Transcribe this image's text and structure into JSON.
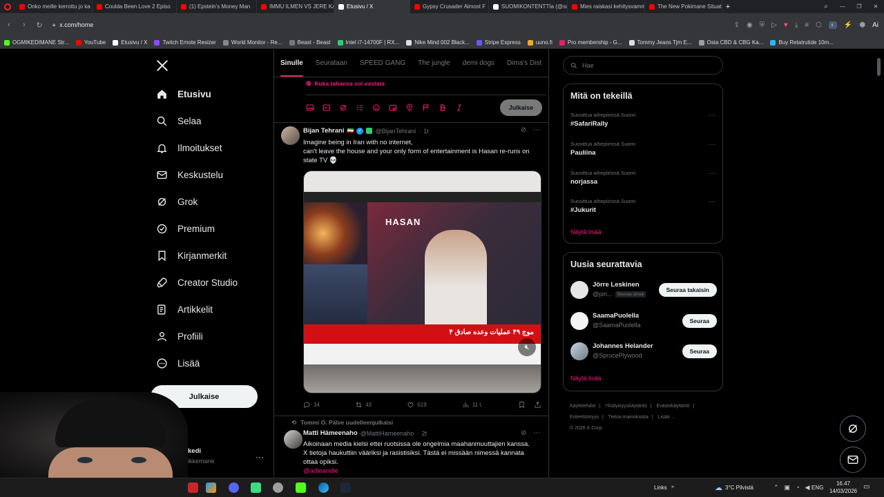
{
  "browser": {
    "tabs": [
      {
        "label": "Onko meille kerrottu jo ka",
        "color": "#ff0000"
      },
      {
        "label": "Coulda Been Love 2 Episo",
        "color": "#ff0000"
      },
      {
        "label": "(1) Epstein's Money Man",
        "color": "#ff0000"
      },
      {
        "label": "IMMU ILMEN VS JERE KA",
        "color": "#ff0000"
      },
      {
        "label": "Etusivu / X",
        "color": "#ffffff"
      },
      {
        "label": "Gypsy Crusader Almost F",
        "color": "#ff0000"
      },
      {
        "label": "SUOMIKONTENTTIa (@su",
        "color": "#ffffff"
      },
      {
        "label": "Mies raiskasi kehitysvamm",
        "color": "#ff0000"
      },
      {
        "label": "The New Pokimane Situat",
        "color": "#ff0000"
      }
    ],
    "url": "x.com/home",
    "bookmarks": [
      {
        "label": "OGMIKEDIMANE Str...",
        "color": "#53fc18"
      },
      {
        "label": "YouTube",
        "color": "#ff0000"
      },
      {
        "label": "Etusivu / X",
        "color": "#ffffff"
      },
      {
        "label": "Twitch Emote Resizer",
        "color": "#9146ff"
      },
      {
        "label": "World Monitor - Re...",
        "color": "#888888"
      },
      {
        "label": "Beast - Beast",
        "color": "#777777"
      },
      {
        "label": "Intel i7-14700F | RX...",
        "color": "#2ecc71"
      },
      {
        "label": "Nike Mind 002 Black...",
        "color": "#dddddd"
      },
      {
        "label": "Stripe Express",
        "color": "#635bff"
      },
      {
        "label": "uuno.fi",
        "color": "#f5a623"
      },
      {
        "label": "Pro membership - G...",
        "color": "#e91e63"
      },
      {
        "label": "Tommy Jeans Tjm E...",
        "color": "#dddddd"
      },
      {
        "label": "Osta CBD & CBG Ka...",
        "color": "#9e9e9e"
      },
      {
        "label": "Buy Retatrutide 10m...",
        "color": "#29b6f6"
      }
    ]
  },
  "nav": {
    "items": [
      {
        "label": "Etusivu",
        "icon": "home-icon"
      },
      {
        "label": "Selaa",
        "icon": "search-icon"
      },
      {
        "label": "Ilmoitukset",
        "icon": "bell-icon"
      },
      {
        "label": "Keskustelu",
        "icon": "mail-icon"
      },
      {
        "label": "Grok",
        "icon": "grok-icon"
      },
      {
        "label": "Premium",
        "icon": "premium-icon"
      },
      {
        "label": "Kirjanmerkit",
        "icon": "bookmark-icon"
      },
      {
        "label": "Creator Studio",
        "icon": "rocket-icon"
      },
      {
        "label": "Artikkelit",
        "icon": "article-icon"
      },
      {
        "label": "Profiili",
        "icon": "profile-icon"
      },
      {
        "label": "Lisää",
        "icon": "more-icon"
      }
    ],
    "post_label": "Julkaise",
    "account_name": "kedi",
    "account_handle": "ikkemane"
  },
  "feed": {
    "tabs": [
      "Sinulle",
      "Seurataan",
      "SPEED GANG",
      "The jungle",
      "demi dogs",
      "Dima's Dist"
    ],
    "active_tab": "Sinulle",
    "composer": {
      "reply_setting": "Kuka tahansa voi vastata",
      "post_label": "Julkaise"
    },
    "tweets": [
      {
        "name": "Bijan Tehrani",
        "handle": "@BijanTehrani",
        "time": "1t",
        "text_lines": [
          "Imagine being in Iran with no internet,",
          "can't leave the house and your only form of entertainment is Hasan re-runs on",
          "state TV 💀"
        ],
        "media": {
          "banner_text": "موج ۴۹ عملیات وعده صادق ۴",
          "overlay_text": "HASAN"
        },
        "stats": {
          "replies": "34",
          "reposts": "43",
          "likes": "519",
          "views": "11 t."
        }
      },
      {
        "repost_context": "Tommi O. Pälve uudelleenjulkaisi",
        "name": "Matti Hämeenaho",
        "handle": "@MattiHameenaho",
        "time": "2t",
        "text_lines": [
          "Aikoinaan media kielsi ettei ruotsissa ole ongelmia maahanmuuttajien kanssa.",
          "X tietoja haukuttiin vääriksi ja rasistisiksi. Tästä ei missään nimessä kannata",
          "ottaa opiksi."
        ],
        "mention": "@adleandle"
      }
    ]
  },
  "sidebar": {
    "search_placeholder": "Hae",
    "trends_title": "Mitä on tekeillä",
    "trends": [
      {
        "context": "Suosittua aihepiirissä Suomi",
        "name": "#SafariRally"
      },
      {
        "context": "Suosittua aihepiirissä Suomi",
        "name": "Pauliina"
      },
      {
        "context": "Suosittua aihepiirissä Suomi",
        "name": "norjassa"
      },
      {
        "context": "Suosittua aihepiirissä Suomi",
        "name": "#Jukurit"
      }
    ],
    "trends_more": "Näytä lisää",
    "follow_title": "Uusia seurattavia",
    "follow": [
      {
        "name": "Jörre Leskinen",
        "handle": "@pin...",
        "badge": "Seuraa sinua",
        "button": "Seuraa takaisin"
      },
      {
        "name": "SaamaPuolella",
        "handle": "@SaamaPuolella",
        "badge": "",
        "button": "Seuraa"
      },
      {
        "name": "Johannes Helander",
        "handle": "@SprucePlywood",
        "badge": "",
        "button": "Seuraa"
      }
    ],
    "follow_more": "Näytä lisää",
    "footer": [
      "Käyttöehdot",
      "Yksityisyyskäytäntö",
      "Evästekäytäntö",
      "Esteettömyys",
      "Tietoa mainoksista",
      "Lisää ...",
      "© 2026 X Corp."
    ]
  },
  "taskbar": {
    "links_label": "Links",
    "weather": "3°C Pilvistä",
    "lang": "ENG",
    "time": "16.47",
    "date": "14/03/2026"
  },
  "colors": {
    "accent": "#f91880",
    "verified": "#1d9bf0",
    "background": "#000000",
    "border": "#2f3336"
  }
}
